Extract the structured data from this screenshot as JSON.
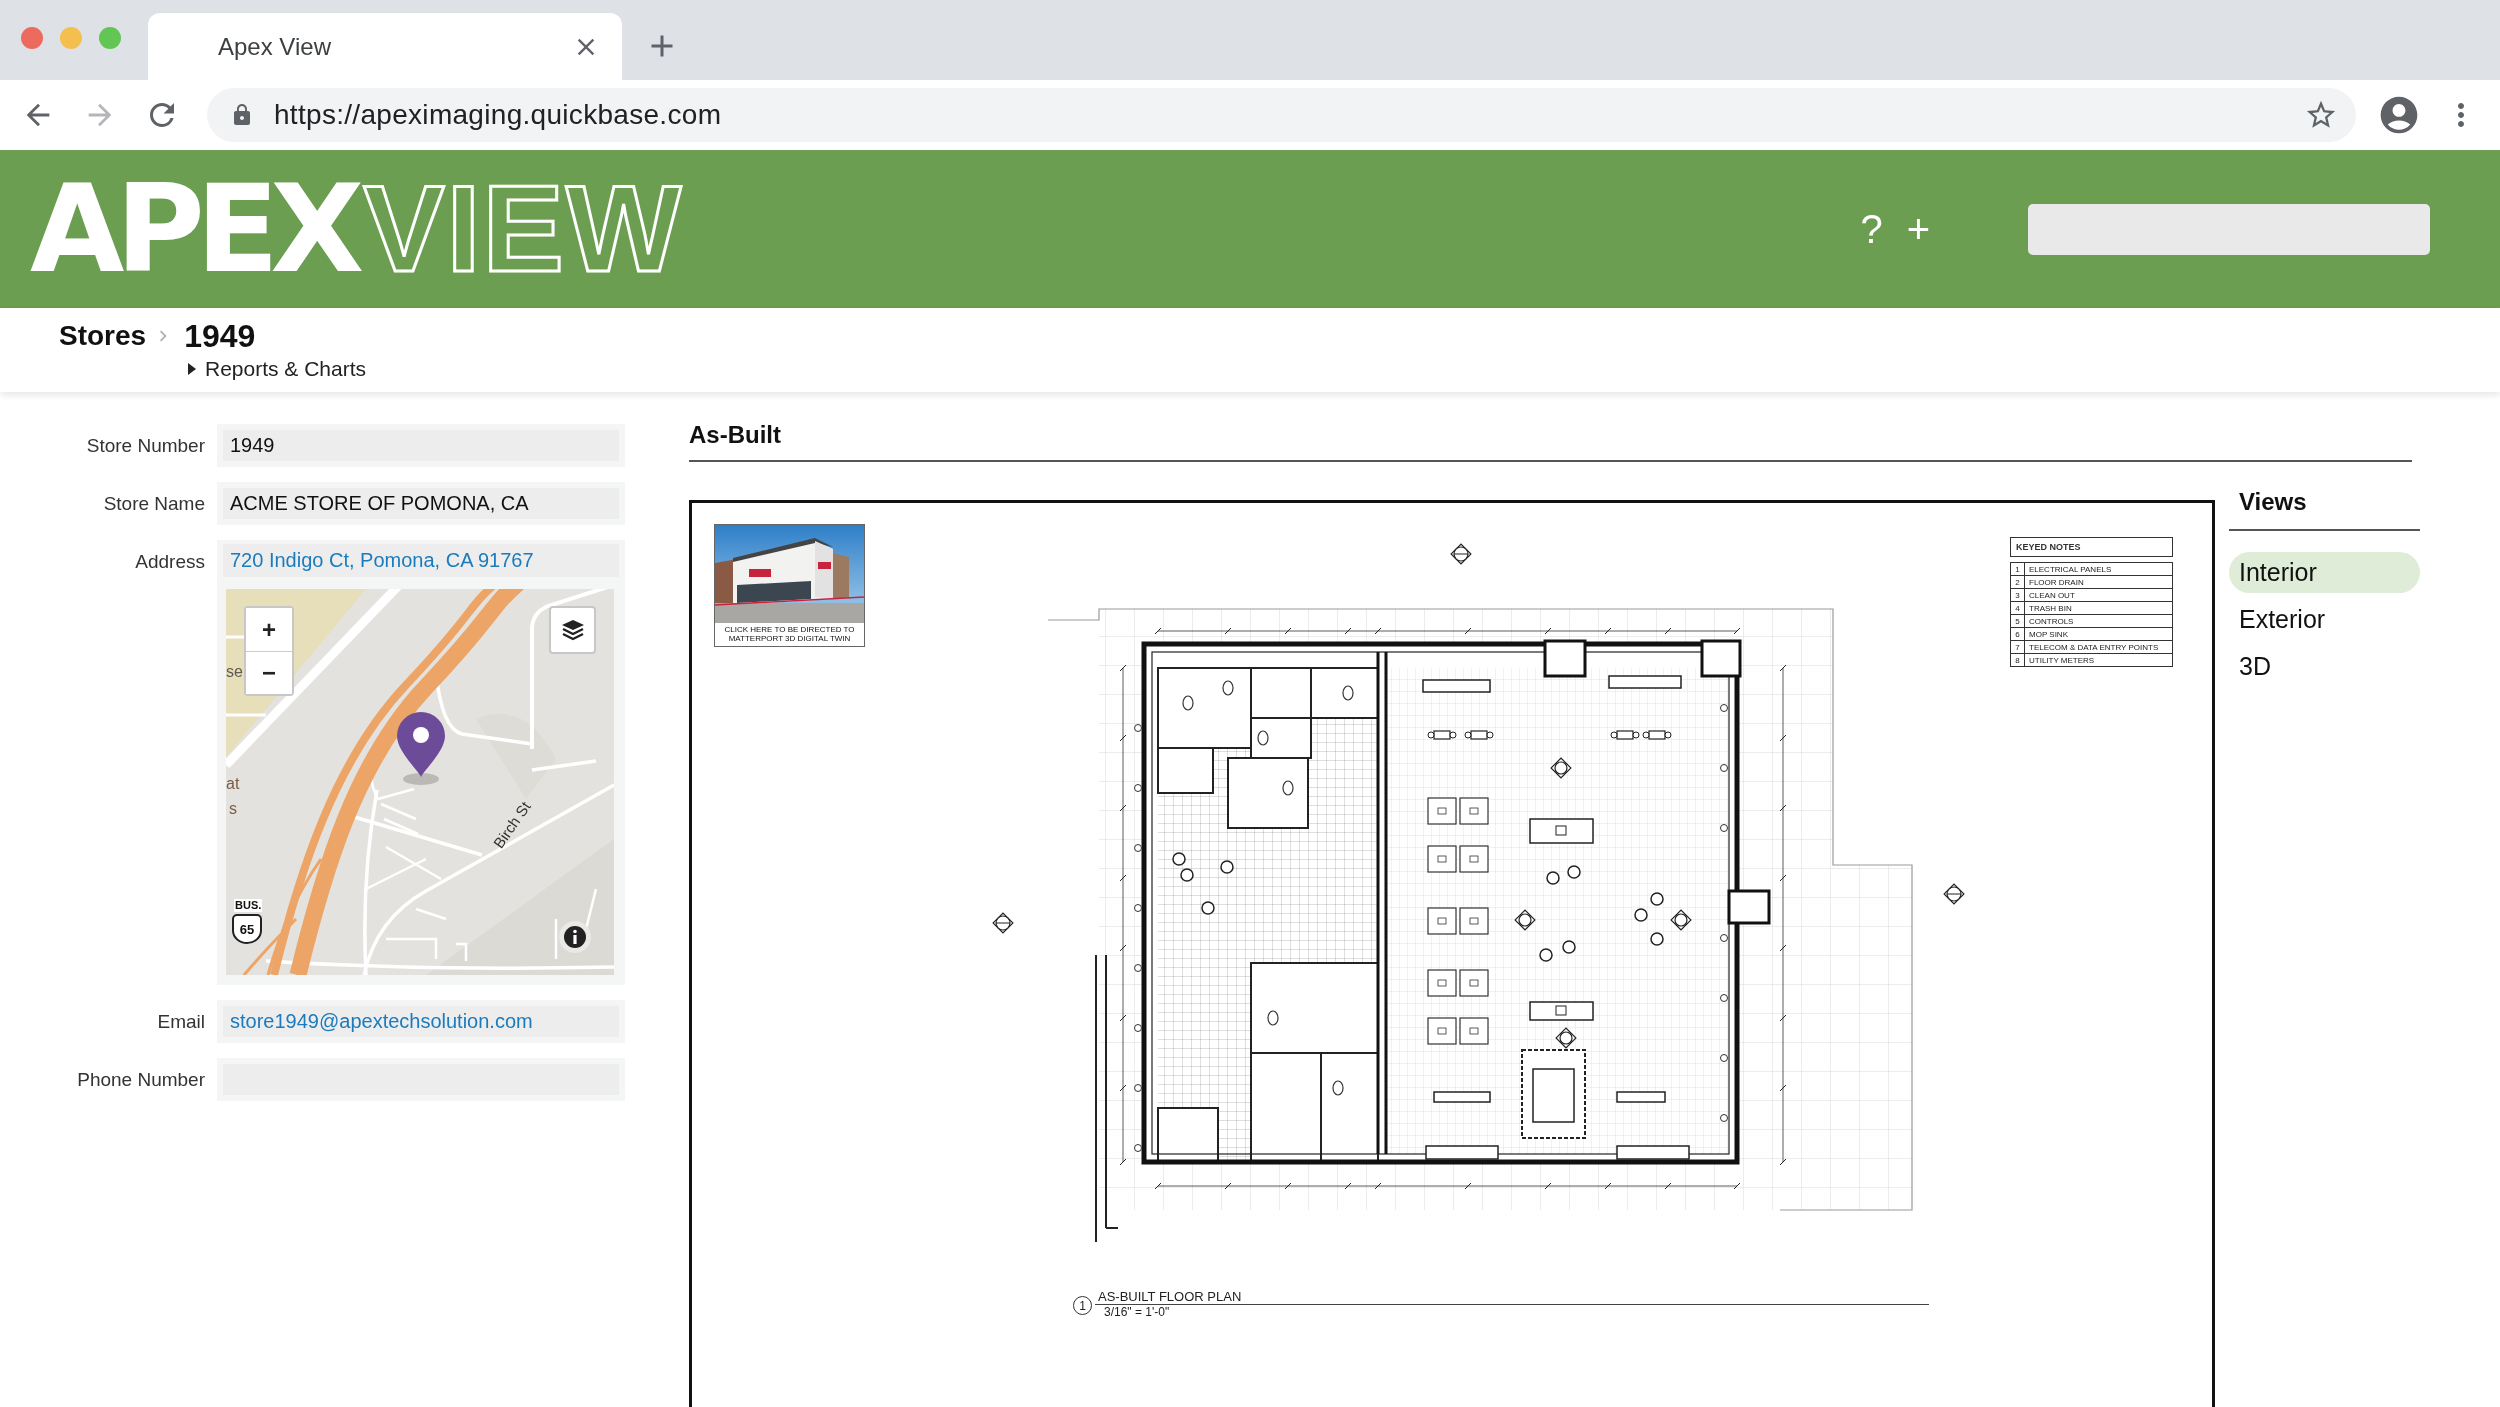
{
  "browser": {
    "tab": {
      "title": "Apex View"
    },
    "forward": {
      "disabled": true
    },
    "address_bar": {
      "url": "https://apeximaging.quickbase.com"
    }
  },
  "header": {
    "logo": {
      "solid": "APEX",
      "outline": "VIEW"
    },
    "help_button": "?",
    "add_button": "+"
  },
  "breadcrumb": {
    "items": [
      "Stores",
      "1949"
    ],
    "submenu": {
      "label": "Reports & Charts",
      "expanded": false
    }
  },
  "record": {
    "fields": [
      {
        "kind": "text",
        "label": "Store Number",
        "value": "1949"
      },
      {
        "kind": "text",
        "label": "Store Name",
        "value": "ACME STORE OF POMONA, CA"
      },
      {
        "kind": "address",
        "label": "Address",
        "value": "720 Indigo Ct, Pomona, CA 91767",
        "map": {
          "zoom_in": "+",
          "zoom_out": "−",
          "place_labels": [
            "se",
            "at",
            "s"
          ],
          "street_label": "Birch St",
          "route_shield": {
            "label": "BUS.",
            "number": "65"
          }
        }
      },
      {
        "kind": "email",
        "label": "Email",
        "value": "store1949@apextechsolution.com"
      },
      {
        "kind": "text",
        "label": "Phone Number"
      }
    ]
  },
  "as_built": {
    "title": "As-Built",
    "sheet": {
      "photo_caption": "CLICK HERE TO BE DIRECTED TO MATTERPORT 3D DIGITAL TWIN",
      "keyed_notes": {
        "title": "KEYED NOTES",
        "rows": [
          {
            "number": "1",
            "text": "ELECTRICAL PANELS"
          },
          {
            "number": "2",
            "text": "FLOOR DRAIN"
          },
          {
            "number": "3",
            "text": "CLEAN OUT"
          },
          {
            "number": "4",
            "text": "TRASH BIN"
          },
          {
            "number": "5",
            "text": "CONTROLS"
          },
          {
            "number": "6",
            "text": "MOP SINK"
          },
          {
            "number": "7",
            "text": "TELECOM & DATA ENTRY POINTS"
          },
          {
            "number": "8",
            "text": "UTILITY METERS"
          }
        ]
      },
      "plan_title": {
        "number": "1",
        "title": "AS-BUILT FLOOR PLAN",
        "scale": "3/16\" = 1'-0\""
      }
    }
  },
  "views": {
    "title": "Views",
    "items": [
      {
        "label": "Interior",
        "selected": true
      },
      {
        "label": "Exterior",
        "selected": false
      },
      {
        "label": "3D",
        "selected": false
      }
    ]
  }
}
